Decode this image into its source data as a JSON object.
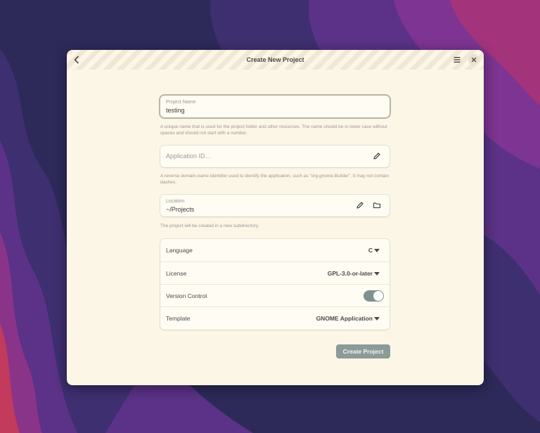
{
  "window": {
    "title": "Create New Project"
  },
  "headerbar": {
    "back_icon": "go-previous-icon",
    "menu_icon": "hamburger-menu-icon",
    "close_icon": "window-close-icon"
  },
  "form": {
    "project_name": {
      "label": "Project Name",
      "value": "testing",
      "hint": "A unique name that is used for the project folder and other resources. The name should be in lower case without spaces and should not start with a number."
    },
    "application_id": {
      "placeholder": "Application ID…",
      "hint": "A reverse domain-name identifier used to identify the application, such as \"org.gnome.Builder\". It may not contain dashes.",
      "edit_icon": "pencil-icon"
    },
    "location": {
      "label": "Location",
      "value": "~/Projects",
      "hint": "The project will be created in a new subdirectory.",
      "edit_icon": "pencil-icon",
      "folder_icon": "folder-icon"
    }
  },
  "options": {
    "language": {
      "label": "Language",
      "value": "C"
    },
    "license": {
      "label": "License",
      "value": "GPL-3.0-or-later"
    },
    "version_control": {
      "label": "Version Control",
      "enabled": true
    },
    "template": {
      "label": "Template",
      "value": "GNOME Application"
    }
  },
  "actions": {
    "create_label": "Create Project"
  },
  "colors": {
    "window_bg": "#fcf6e6",
    "accent_button": "#8c9b97",
    "switch_on": "#7f918c",
    "wallpaper": [
      "#2d2a5a",
      "#3d2f6e",
      "#5a3285",
      "#7b3390",
      "#a13378",
      "#c23a5c"
    ]
  }
}
